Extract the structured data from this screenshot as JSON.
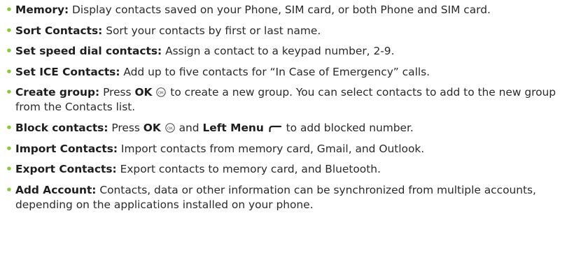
{
  "colors": {
    "bullet": "#8cc63f",
    "text": "#2a2a2a"
  },
  "bullet_glyph": "•",
  "items": [
    {
      "term": "Memory:",
      "text": " Display contacts saved on your Phone, SIM card, or both Phone and SIM card."
    },
    {
      "term": "Sort Contacts:",
      "text": " Sort your contacts by first or last name."
    },
    {
      "term": "Set speed dial contacts:",
      "text": " Assign a contact to a keypad number, 2-9."
    },
    {
      "term": "Set ICE Contacts:",
      "text": " Add up to five contacts for “In Case of Emergency” calls."
    },
    {
      "term": "Create group:",
      "text_a": " Press ",
      "ok": "OK",
      "text_b": " to create a new group. You can select contacts to add to the new group from the Contacts list."
    },
    {
      "term": "Block contacts:",
      "text_a": " Press ",
      "ok": "OK",
      "text_b": " and ",
      "left_menu": "Left Menu",
      "text_c": " to add blocked number."
    },
    {
      "term": "Import Contacts:",
      "text": " Import contacts from memory card, Gmail, and Outlook."
    },
    {
      "term": "Export Contacts:",
      "text": " Export contacts to memory card, and Bluetooth."
    },
    {
      "term": "Add Account:",
      "text": " Contacts, data or other information can be synchronized from multiple accounts, depending on the applications installed on your phone."
    }
  ],
  "icons": {
    "ok_button": "ok-button-icon",
    "left_menu_key": "left-menu-key-icon"
  }
}
